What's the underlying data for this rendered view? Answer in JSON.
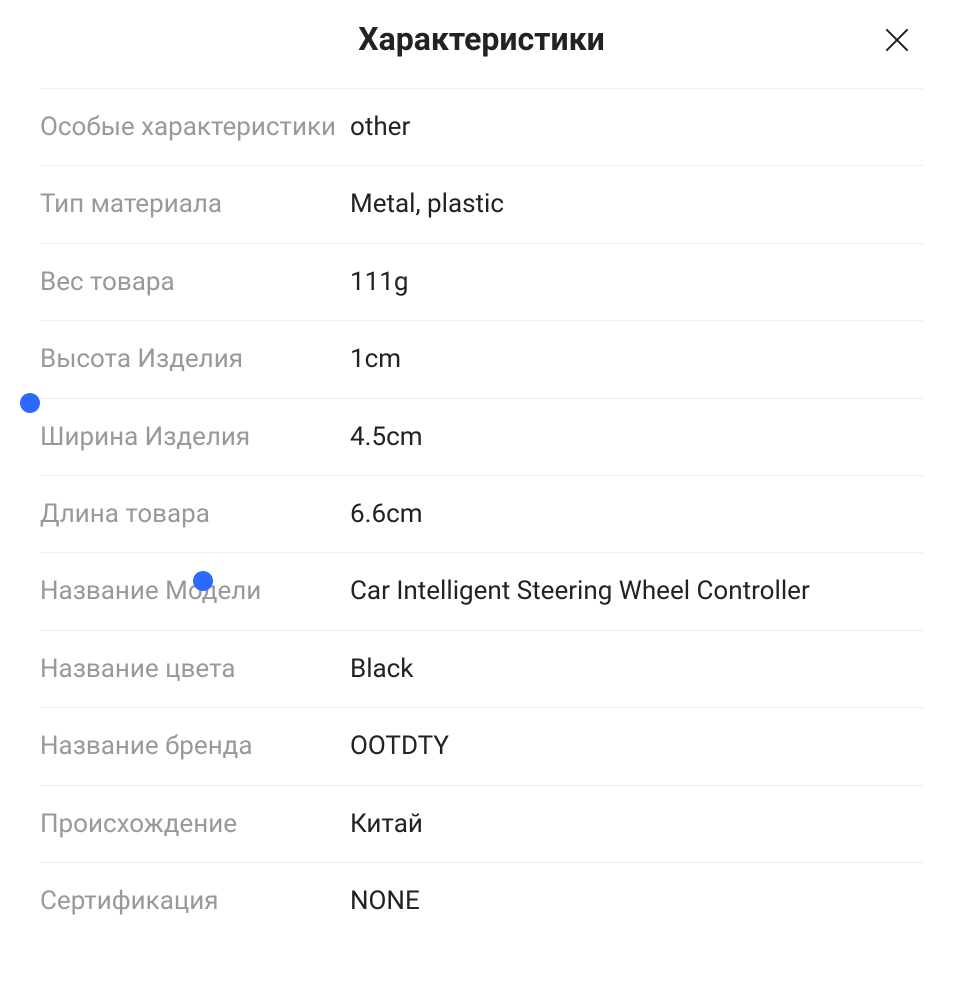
{
  "header": {
    "title": "Характеристики"
  },
  "specs": [
    {
      "label": "Особые характеристики",
      "value": "other"
    },
    {
      "label": "Тип материала",
      "value": "Metal, plastic"
    },
    {
      "label": "Вес товара",
      "value": "111g"
    },
    {
      "label": "Высота Изделия",
      "value": "1cm"
    },
    {
      "label": "Ширина Изделия",
      "value": "4.5cm"
    },
    {
      "label": "Длина товара",
      "value": "6.6cm"
    },
    {
      "label": "Название Модели",
      "value": "Car Intelligent Steering Wheel Controller"
    },
    {
      "label": "Название цвета",
      "value": "Black"
    },
    {
      "label": "Название бренда",
      "value": "OOTDTY"
    },
    {
      "label": "Происхождение",
      "value": "Китай"
    },
    {
      "label": "Сертификация",
      "value": "NONE"
    }
  ]
}
